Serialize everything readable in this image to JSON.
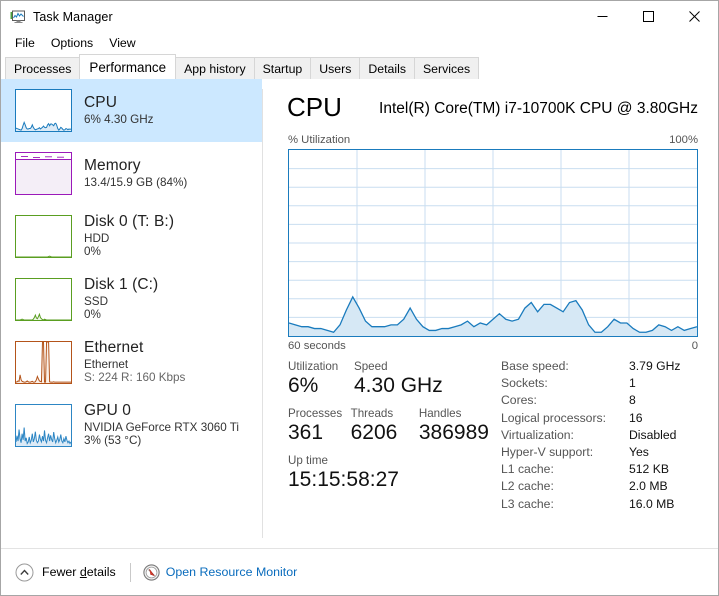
{
  "window": {
    "title": "Task Manager",
    "icon": "task-manager-icon",
    "controls": {
      "minimize": "—",
      "maximize": "☐",
      "close": "✕"
    }
  },
  "menu": {
    "items": [
      "File",
      "Options",
      "View"
    ]
  },
  "tabs": {
    "items": [
      "Processes",
      "Performance",
      "App history",
      "Startup",
      "Users",
      "Details",
      "Services"
    ],
    "active": "Performance"
  },
  "sidebar": {
    "items": [
      {
        "name": "cpu",
        "title": "CPU",
        "sub": "6%  4.30 GHz",
        "sub2": "",
        "color": "#1a7bbd",
        "selected": true
      },
      {
        "name": "memory",
        "title": "Memory",
        "sub": "13.4/15.9 GB (84%)",
        "sub2": "",
        "color": "#9b19b9",
        "selected": false
      },
      {
        "name": "disk-0",
        "title": "Disk 0 (T: B:)",
        "sub": "HDD",
        "sub2": "0%",
        "color": "#5a9e21",
        "selected": false
      },
      {
        "name": "disk-1",
        "title": "Disk 1 (C:)",
        "sub": "SSD",
        "sub2": "0%",
        "color": "#5a9e21",
        "selected": false
      },
      {
        "name": "ethernet",
        "title": "Ethernet",
        "sub": "Ethernet",
        "sub2": "S: 224 R: 160 Kbps",
        "color": "#b4541a",
        "selected": false
      },
      {
        "name": "gpu-0",
        "title": "GPU 0",
        "sub": "NVIDIA GeForce RTX 3060 Ti",
        "sub2": "3%  (53 °C)",
        "color": "#2d86c4",
        "selected": false
      }
    ]
  },
  "main": {
    "heading": "CPU",
    "model": "Intel(R) Core(TM) i7-10700K CPU @ 3.80GHz",
    "graph_top_label": "% Utilization",
    "graph_top_right": "100%",
    "graph_left_label": "60 seconds",
    "graph_right_label": "0",
    "stats": {
      "utilization_caption": "Utilization",
      "utilization_value": "6%",
      "speed_caption": "Speed",
      "speed_value": "4.30 GHz",
      "processes_caption": "Processes",
      "processes_value": "361",
      "threads_caption": "Threads",
      "threads_value": "6206",
      "handles_caption": "Handles",
      "handles_value": "386989",
      "uptime_caption": "Up time",
      "uptime_value": "15:15:58:27"
    },
    "details": [
      {
        "key": "Base speed:",
        "value": "3.79 GHz"
      },
      {
        "key": "Sockets:",
        "value": "1"
      },
      {
        "key": "Cores:",
        "value": "8"
      },
      {
        "key": "Logical processors:",
        "value": "16"
      },
      {
        "key": "Virtualization:",
        "value": "Disabled"
      },
      {
        "key": "Hyper-V support:",
        "value": "Yes"
      },
      {
        "key": "L1 cache:",
        "value": "512 KB"
      },
      {
        "key": "L2 cache:",
        "value": "2.0 MB"
      },
      {
        "key": "L3 cache:",
        "value": "16.0 MB"
      }
    ]
  },
  "footer": {
    "chevron_icon": "chevron-up-icon",
    "fewer_details_pre": "Fewer ",
    "fewer_details_underlined": "d",
    "fewer_details_post": "etails",
    "resource_monitor_icon": "resource-monitor-icon",
    "resource_monitor_label": "Open Resource Monitor",
    "link_color": "#0a6cbd"
  },
  "chart_data": {
    "type": "area",
    "title": "CPU % Utilization",
    "xlabel": "60 seconds",
    "ylabel": "% Utilization",
    "ylim": [
      0,
      100
    ],
    "xlim": [
      60,
      0
    ],
    "grid": true,
    "line_color": "#1a7bbd",
    "fill_color": "#d6e8f5",
    "grid_color": "#c9def0",
    "grid_cols": 6,
    "grid_rows": 10,
    "series": [
      {
        "name": "CPU utilization",
        "values": [
          7,
          6,
          5,
          5,
          4,
          4,
          3,
          2,
          6,
          14,
          21,
          15,
          8,
          5,
          5,
          5,
          6,
          6,
          9,
          15,
          9,
          5,
          3,
          3,
          4,
          4,
          5,
          6,
          8,
          5,
          7,
          6,
          9,
          12,
          9,
          8,
          9,
          15,
          18,
          13,
          17,
          17,
          15,
          13,
          18,
          19,
          14,
          6,
          2,
          2,
          5,
          9,
          7,
          7,
          4,
          2,
          2,
          3,
          6,
          5,
          3,
          5,
          3,
          4,
          5
        ]
      }
    ]
  },
  "thumbs": {
    "cpu": [
      7,
      6,
      5,
      4,
      3,
      2,
      6,
      14,
      21,
      15,
      8,
      5,
      5,
      6,
      6,
      9,
      15,
      9,
      5,
      3,
      4,
      5,
      6,
      8,
      5,
      7,
      9,
      12,
      9,
      8,
      9,
      15,
      18,
      13,
      17,
      17,
      15,
      13,
      18,
      19,
      14,
      6,
      2,
      5,
      9,
      7,
      4,
      2,
      3,
      6,
      5,
      3,
      5,
      4,
      5
    ],
    "memory_level": 84,
    "disk0": [
      0,
      0,
      0,
      0,
      0,
      0,
      0,
      0,
      0,
      0,
      0,
      0,
      0,
      0,
      0,
      0,
      0,
      0,
      0,
      0,
      0,
      0,
      0,
      0,
      0,
      0,
      0,
      0,
      0,
      0,
      0,
      0,
      1,
      2,
      1,
      0,
      0,
      0,
      0,
      0,
      0,
      0,
      0,
      0,
      0,
      0,
      0,
      0,
      0,
      0,
      0,
      0,
      0,
      0,
      0
    ],
    "disk1": [
      0,
      0,
      0,
      0,
      0,
      1,
      2,
      1,
      0,
      0,
      0,
      0,
      0,
      0,
      0,
      0,
      0,
      2,
      6,
      12,
      5,
      3,
      8,
      14,
      6,
      3,
      1,
      0,
      2,
      1,
      0,
      0,
      0,
      0,
      0,
      0,
      0,
      0,
      0,
      0,
      0,
      0,
      0,
      0,
      0,
      0,
      0,
      0,
      0,
      0,
      0,
      0,
      0,
      0,
      0
    ],
    "ethernet": [
      2,
      3,
      5,
      4,
      20,
      8,
      4,
      3,
      2,
      2,
      3,
      5,
      3,
      2,
      2,
      3,
      4,
      2,
      2,
      3,
      8,
      16,
      10,
      5,
      4,
      3,
      100,
      100,
      2,
      2,
      100,
      100,
      100,
      3,
      2,
      2,
      2,
      3,
      2,
      2,
      2,
      2,
      2,
      2,
      2,
      2,
      2,
      2,
      2,
      2,
      2,
      2,
      2,
      2,
      2
    ],
    "gpu": [
      10,
      25,
      12,
      40,
      18,
      8,
      30,
      15,
      45,
      12,
      20,
      6,
      10,
      22,
      8,
      14,
      30,
      10,
      18,
      35,
      14,
      8,
      12,
      28,
      16,
      10,
      24,
      12,
      38,
      14,
      8,
      20,
      30,
      12,
      26,
      16,
      10,
      34,
      18,
      8,
      14,
      22,
      10,
      16,
      28,
      12,
      8,
      18,
      10,
      24,
      14,
      8,
      12,
      6,
      10
    ]
  }
}
